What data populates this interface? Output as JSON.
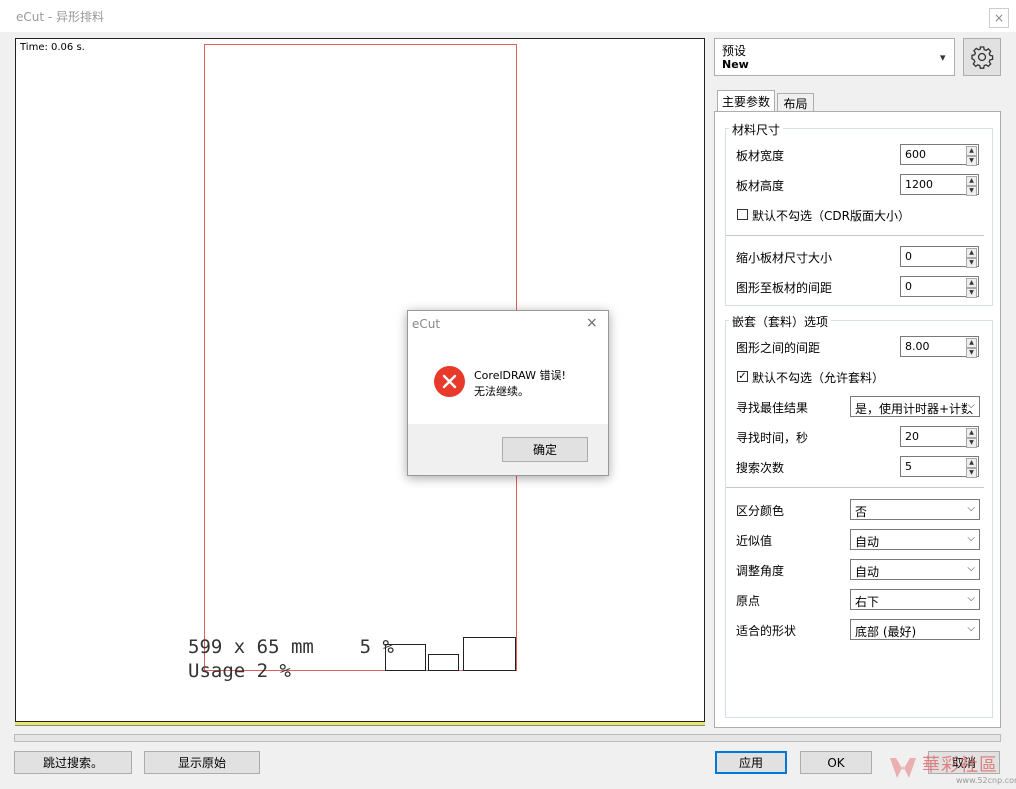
{
  "window": {
    "title": "eCut - 异形排料",
    "close": "×"
  },
  "canvas": {
    "time_label": "Time: 0.06 s.",
    "info_line1": "599 x 65 mm    5 %",
    "info_line2": "Usage 2 %"
  },
  "bottom": {
    "skip_search": "跳过搜索。",
    "show_original": "显示原始",
    "apply": "应用",
    "ok": "OK",
    "cancel": "取消"
  },
  "preset": {
    "label": "预设",
    "value": "New"
  },
  "tabs": [
    {
      "label": "主要参数"
    },
    {
      "label": "布局"
    }
  ],
  "material": {
    "title": "材料尺寸",
    "width_label": "板材宽度",
    "width_value": "600",
    "height_label": "板材高度",
    "height_value": "1200",
    "default_cdr_label": "默认不勾选（CDR版面大小）",
    "shrink_label": "缩小板材尺寸大小",
    "shrink_value": "0",
    "gap_to_sheet_label": "图形至板材的间距",
    "gap_to_sheet_value": "0"
  },
  "nesting": {
    "title": "嵌套（套料）选项",
    "gap_label": "图形之间的间距",
    "gap_value": "8.00",
    "allow_nest_label": "默认不勾选（允许套料）",
    "best_label": "寻找最佳结果",
    "best_value": "是，使用计时器+计数",
    "time_label": "寻找时间，秒",
    "time_value": "20",
    "count_label": "搜索次数",
    "count_value": "5",
    "color_label": "区分颜色",
    "color_value": "否",
    "approx_label": "近似值",
    "approx_value": "自动",
    "angle_label": "调整角度",
    "angle_value": "自动",
    "origin_label": "原点",
    "origin_value": "右下",
    "shape_label": "适合的形状",
    "shape_value": "底部 (最好)"
  },
  "dialog": {
    "title": "eCut",
    "close": "×",
    "message1": "CorelDRAW 错误!",
    "message2": "无法继续。",
    "ok": "确定"
  },
  "watermark": {
    "text": "華彩社區",
    "url": "www.52cnp.com"
  },
  "colors": {
    "accent": "#0078d7",
    "sheet_border": "#e06060",
    "error_red": "#e8392a"
  }
}
